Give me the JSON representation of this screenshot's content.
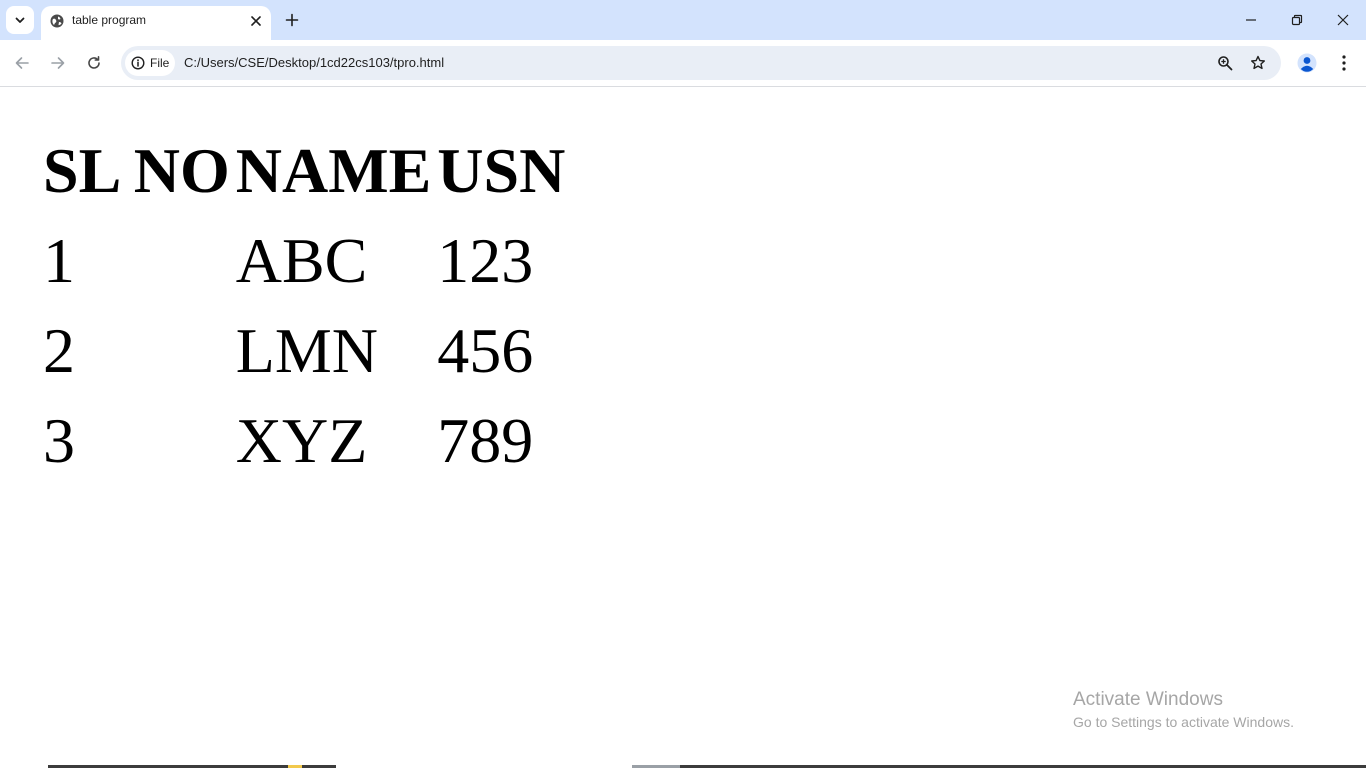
{
  "browser": {
    "tab": {
      "title": "table program"
    },
    "toolbar": {
      "chip_label": "File",
      "url": "C:/Users/CSE/Desktop/1cd22cs103/tpro.html"
    },
    "icons": {
      "tab_search": "chevron-down-icon",
      "favicon": "globe-icon",
      "tab_close": "close-icon",
      "new_tab": "plus-icon",
      "back": "arrow-left-icon",
      "forward": "arrow-right-icon",
      "reload": "reload-icon",
      "site_info": "info-icon",
      "zoom": "zoom-icon",
      "bookmark": "star-icon",
      "profile": "person-icon",
      "menu": "kebab-menu-icon",
      "minimize": "minimize-icon",
      "restore": "restore-icon",
      "close_window": "close-icon"
    },
    "colors": {
      "tabstrip": "#d3e3fd",
      "omnibox": "#e9eef6",
      "profile": "#0b57d0"
    }
  },
  "page": {
    "table": {
      "headers": [
        "SL NO",
        "NAME",
        "USN"
      ],
      "rows": [
        [
          "1",
          "ABC",
          "123"
        ],
        [
          "2",
          "LMN",
          "456"
        ],
        [
          "3",
          "XYZ",
          "789"
        ]
      ]
    }
  },
  "watermark": {
    "title": "Activate Windows",
    "subtitle": "Go to Settings to activate Windows."
  }
}
